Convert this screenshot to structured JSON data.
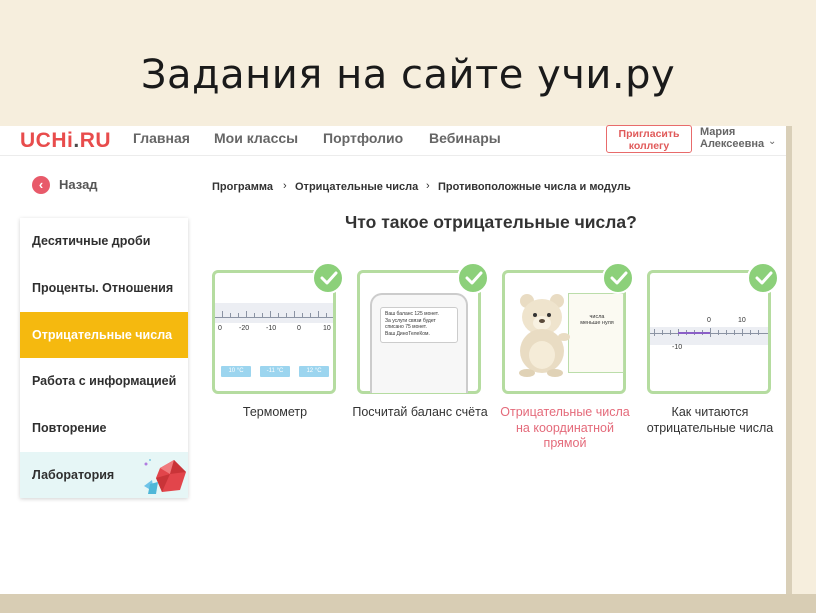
{
  "slide": {
    "title": "Задания на сайте учи.ру"
  },
  "header": {
    "logo": "UCHi.RU",
    "nav": [
      "Главная",
      "Мои классы",
      "Портфолио",
      "Вебинары"
    ],
    "invite_line1": "Пригласить",
    "invite_line2": "коллегу",
    "user_line1": "Мария",
    "user_line2": "Алексеевна"
  },
  "back": {
    "label": "Назад"
  },
  "sidebar": {
    "items": [
      {
        "label": "Десятичные дроби"
      },
      {
        "label": "Проценты. Отношения"
      },
      {
        "label": "Отрицательные числа"
      },
      {
        "label": "Работа с информацией"
      },
      {
        "label": "Повторение"
      },
      {
        "label": "Лаборатория"
      }
    ],
    "active_index": 2
  },
  "breadcrumb": [
    "Программа",
    "Отрицательные числа",
    "Противоположные числа и модуль"
  ],
  "page_title": "Что такое отрицательные числа?",
  "cards": [
    {
      "label": "Термометр",
      "done": true
    },
    {
      "label": "Посчитай баланс счёта",
      "done": true
    },
    {
      "label": "Отрицательные числа на координатной прямой",
      "done": true
    },
    {
      "label": "Как читаются отрицательные числа",
      "done": true
    }
  ],
  "thermometer": {
    "ticks": [
      "0",
      "-20",
      "-10",
      "0",
      "10"
    ],
    "chips": [
      "10 °C",
      "-11 °C",
      "12 °C"
    ]
  },
  "phone_message": {
    "lines": [
      "Ваш баланс 125 монет.",
      "За услуги связи будет",
      "списано 75 монет.",
      "Ваш ДиноТелеКом."
    ]
  },
  "board": {
    "line1": "числа",
    "line2": "меньше нуля"
  },
  "numberline": {
    "top": [
      "0",
      "10"
    ],
    "bottom": [
      "-10"
    ]
  },
  "colors": {
    "accent_yellow": "#f5b90f",
    "brand_red": "#e84c4c",
    "done_green": "#8cd07a",
    "card_border": "#b5dca0"
  }
}
